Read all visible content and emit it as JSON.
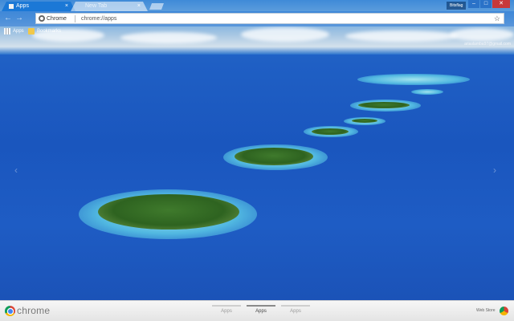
{
  "browser": {
    "tabs": [
      {
        "label": "Apps",
        "active": true
      },
      {
        "label": "New Tab",
        "active": false
      }
    ],
    "profile_name": "Bitsflag",
    "window_controls": {
      "minimize": "–",
      "maximize": "□",
      "close": "✕"
    }
  },
  "toolbar": {
    "back_icon": "back-arrow-icon",
    "forward_icon": "forward-arrow-icon",
    "address": {
      "chip": "Chrome",
      "url": "chrome://apps"
    }
  },
  "bookmarks": {
    "apps_label": "Apps",
    "bookmarks_label": "Bookmarks"
  },
  "account_email": "ariaslamba97@gmail.com",
  "bottom": {
    "brand": "chrome",
    "page_tabs": [
      {
        "label": "Apps",
        "selected": false
      },
      {
        "label": "Apps",
        "selected": true
      },
      {
        "label": "Apps",
        "selected": false
      }
    ],
    "webstore_label": "Web Store"
  },
  "theme": {
    "accent": "#1b78d6",
    "close_red": "#c7383a"
  }
}
